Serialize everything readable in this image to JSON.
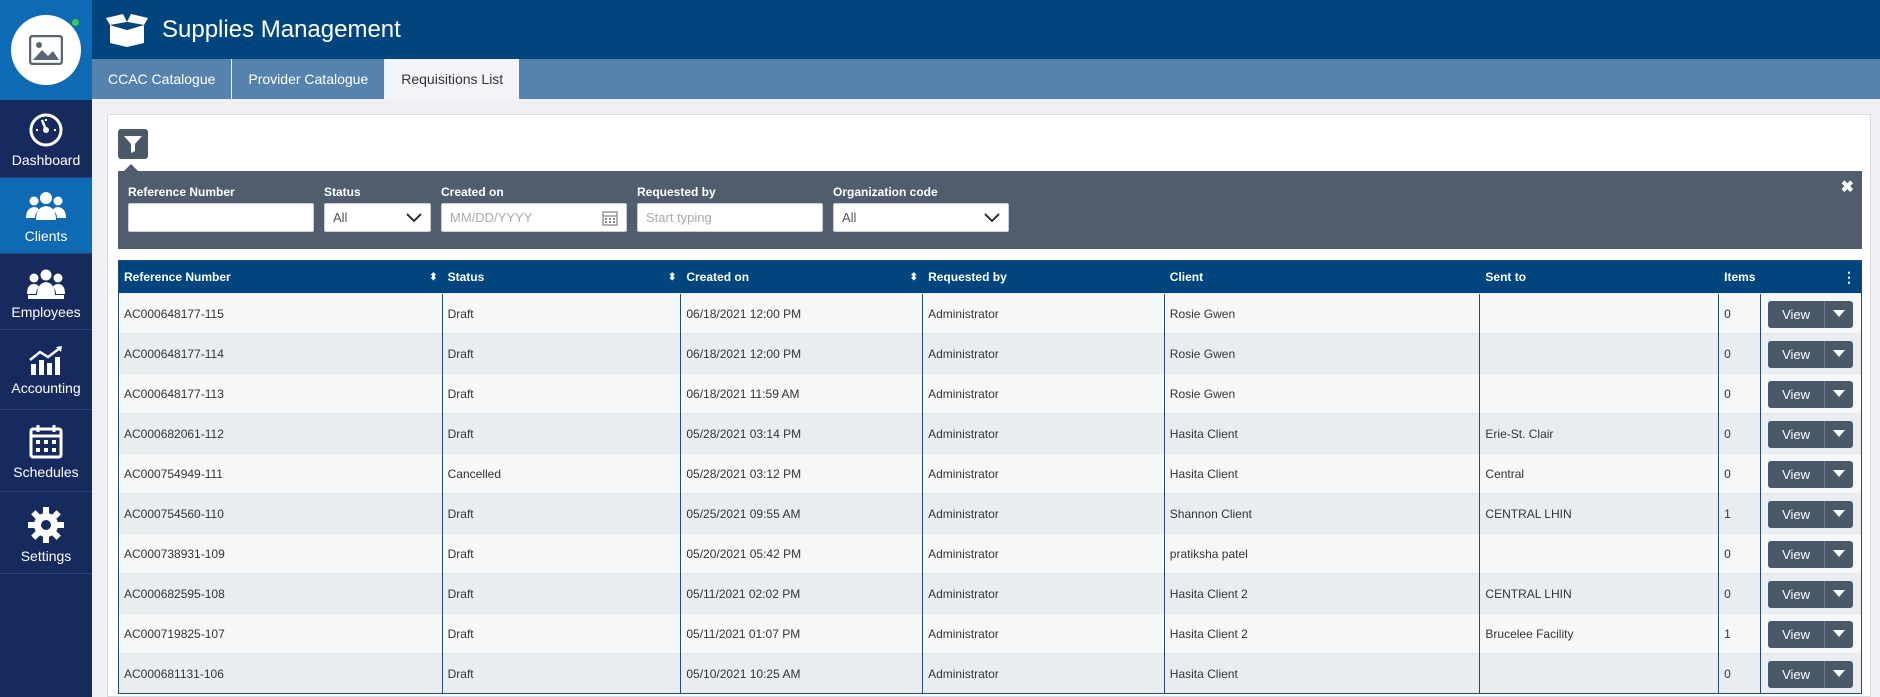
{
  "app": {
    "title": "Supplies Management"
  },
  "sidebar": {
    "items": [
      {
        "label": "Dashboard",
        "icon": "dashboard-gauge-icon"
      },
      {
        "label": "Clients",
        "icon": "clients-group-icon",
        "active": true
      },
      {
        "label": "Employees",
        "icon": "employees-group-icon"
      },
      {
        "label": "Accounting",
        "icon": "accounting-chart-icon"
      },
      {
        "label": "Schedules",
        "icon": "calendar-icon"
      },
      {
        "label": "Settings",
        "icon": "gear-icon"
      }
    ]
  },
  "tabs": [
    {
      "label": "CCAC Catalogue",
      "active": false
    },
    {
      "label": "Provider Catalogue",
      "active": false
    },
    {
      "label": "Requisitions List",
      "active": true
    }
  ],
  "filters": {
    "reference_number": {
      "label": "Reference Number",
      "value": ""
    },
    "status": {
      "label": "Status",
      "value": "All"
    },
    "created_on": {
      "label": "Created on",
      "placeholder": "MM/DD/YYYY"
    },
    "requested_by": {
      "label": "Requested by",
      "placeholder": "Start typing"
    },
    "organization_code": {
      "label": "Organization code",
      "value": "All"
    },
    "close": "✖"
  },
  "table": {
    "columns": [
      "Reference Number",
      "Status",
      "Created on",
      "Requested by",
      "Client",
      "Sent to",
      "Items"
    ],
    "view_label": "View",
    "rows": [
      {
        "ref": "AC000648177-115",
        "status": "Draft",
        "created": "06/18/2021 12:00 PM",
        "requested_by": "Administrator",
        "client": "Rosie Gwen",
        "sent_to": "",
        "items": "0"
      },
      {
        "ref": "AC000648177-114",
        "status": "Draft",
        "created": "06/18/2021 12:00 PM",
        "requested_by": "Administrator",
        "client": "Rosie Gwen",
        "sent_to": "",
        "items": "0"
      },
      {
        "ref": "AC000648177-113",
        "status": "Draft",
        "created": "06/18/2021 11:59 AM",
        "requested_by": "Administrator",
        "client": "Rosie Gwen",
        "sent_to": "",
        "items": "0"
      },
      {
        "ref": "AC000682061-112",
        "status": "Draft",
        "created": "05/28/2021 03:14 PM",
        "requested_by": "Administrator",
        "client": "Hasita Client",
        "sent_to": "Erie-St. Clair",
        "items": "0"
      },
      {
        "ref": "AC000754949-111",
        "status": "Cancelled",
        "created": "05/28/2021 03:12 PM",
        "requested_by": "Administrator",
        "client": "Hasita Client",
        "sent_to": "Central",
        "items": "0"
      },
      {
        "ref": "AC000754560-110",
        "status": "Draft",
        "created": "05/25/2021 09:55 AM",
        "requested_by": "Administrator",
        "client": "Shannon Client",
        "sent_to": "CENTRAL LHIN",
        "items": "1"
      },
      {
        "ref": "AC000738931-109",
        "status": "Draft",
        "created": "05/20/2021 05:42 PM",
        "requested_by": "Administrator",
        "client": "pratiksha patel",
        "sent_to": "",
        "items": "0"
      },
      {
        "ref": "AC000682595-108",
        "status": "Draft",
        "created": "05/11/2021 02:02 PM",
        "requested_by": "Administrator",
        "client": "Hasita Client 2",
        "sent_to": "CENTRAL LHIN",
        "items": "0"
      },
      {
        "ref": "AC000719825-107",
        "status": "Draft",
        "created": "05/11/2021 01:07 PM",
        "requested_by": "Administrator",
        "client": "Hasita Client 2",
        "sent_to": "Brucelee Facility",
        "items": "1"
      },
      {
        "ref": "AC000681131-106",
        "status": "Draft",
        "created": "05/10/2021 10:25 AM",
        "requested_by": "Administrator",
        "client": "Hasita Client",
        "sent_to": "",
        "items": "0"
      }
    ]
  },
  "colors": {
    "header": "#00457e",
    "sidebar": "#162a5e",
    "accent": "#0f6ab4",
    "tabbar": "#5683ad",
    "filterbar": "#4f5d6c"
  }
}
